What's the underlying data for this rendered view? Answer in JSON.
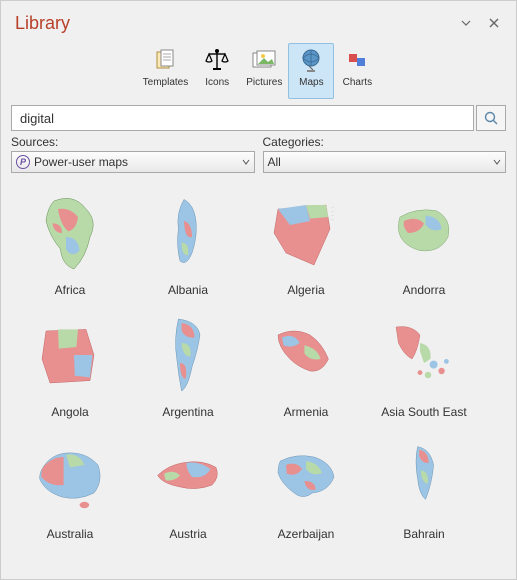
{
  "header": {
    "title": "Library"
  },
  "ribbon": {
    "items": [
      {
        "label": "Templates"
      },
      {
        "label": "Icons"
      },
      {
        "label": "Pictures"
      },
      {
        "label": "Maps"
      },
      {
        "label": "Charts"
      }
    ],
    "active_index": 3
  },
  "search": {
    "value": "digital"
  },
  "filters": {
    "sources": {
      "label": "Sources:",
      "value": "Power-user maps"
    },
    "categories": {
      "label": "Categories:",
      "value": "All"
    }
  },
  "grid": {
    "items": [
      {
        "label": "Africa"
      },
      {
        "label": "Albania"
      },
      {
        "label": "Algeria"
      },
      {
        "label": "Andorra"
      },
      {
        "label": "Angola"
      },
      {
        "label": "Argentina"
      },
      {
        "label": "Armenia"
      },
      {
        "label": "Asia South East"
      },
      {
        "label": "Australia"
      },
      {
        "label": "Austria"
      },
      {
        "label": "Azerbaijan"
      },
      {
        "label": "Bahrain"
      }
    ]
  }
}
